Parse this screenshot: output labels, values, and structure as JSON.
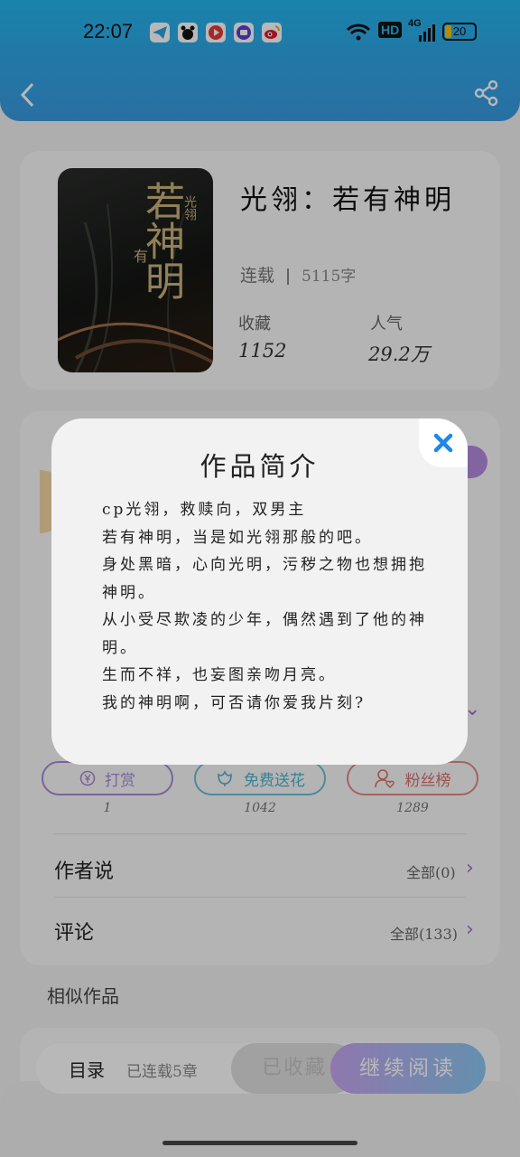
{
  "status_bar": {
    "time": "22:07",
    "network": "HD",
    "signal": "4G",
    "battery": "20"
  },
  "header": {
    "back_icon": "chevron-left-icon",
    "share_icon": "share-icon"
  },
  "book": {
    "title": "光翎：若有神明",
    "status": "连载",
    "word_count": "5115字",
    "collect_label": "收藏",
    "collect_value": "1152",
    "popularity_label": "人气",
    "popularity_value": "29.2万",
    "cover_text": {
      "big": "若神明",
      "small": "光翎",
      "have": "有"
    }
  },
  "actions": [
    {
      "label": "打赏",
      "count": "1",
      "icon": "yen-icon",
      "color": "#a98ad8"
    },
    {
      "label": "免费送花",
      "count": "1042",
      "icon": "flower-icon",
      "color": "#6cc0d6"
    },
    {
      "label": "粉丝榜",
      "count": "1289",
      "icon": "fan-ranking-icon",
      "color": "#e28a8a"
    }
  ],
  "sections": {
    "author_says": {
      "title": "作者说",
      "right": "全部(0)"
    },
    "comments": {
      "title": "评论",
      "right": "全部(133)"
    },
    "similar": "相似作品"
  },
  "bottom_bar": {
    "toc_label": "目录",
    "toc_sub": "已连载5章",
    "collected_label": "已收藏",
    "read_label": "继续阅读"
  },
  "modal": {
    "title": "作品简介",
    "lines": [
      "cp光翎，救赎向，双男主",
      "若有神明，当是如光翎那般的吧。",
      "身处黑暗，心向光明，污秽之物也想拥抱神明。",
      "从小受尽欺凌的少年，偶然遇到了他的神明。",
      "生而不祥，也妄图亲吻月亮。",
      "我的神明啊，可否请你爱我片刻?"
    ],
    "close_icon": "close-icon"
  },
  "colors": {
    "header_blue": "#2ea8e8",
    "accent_purple": "#9b6fd6"
  }
}
